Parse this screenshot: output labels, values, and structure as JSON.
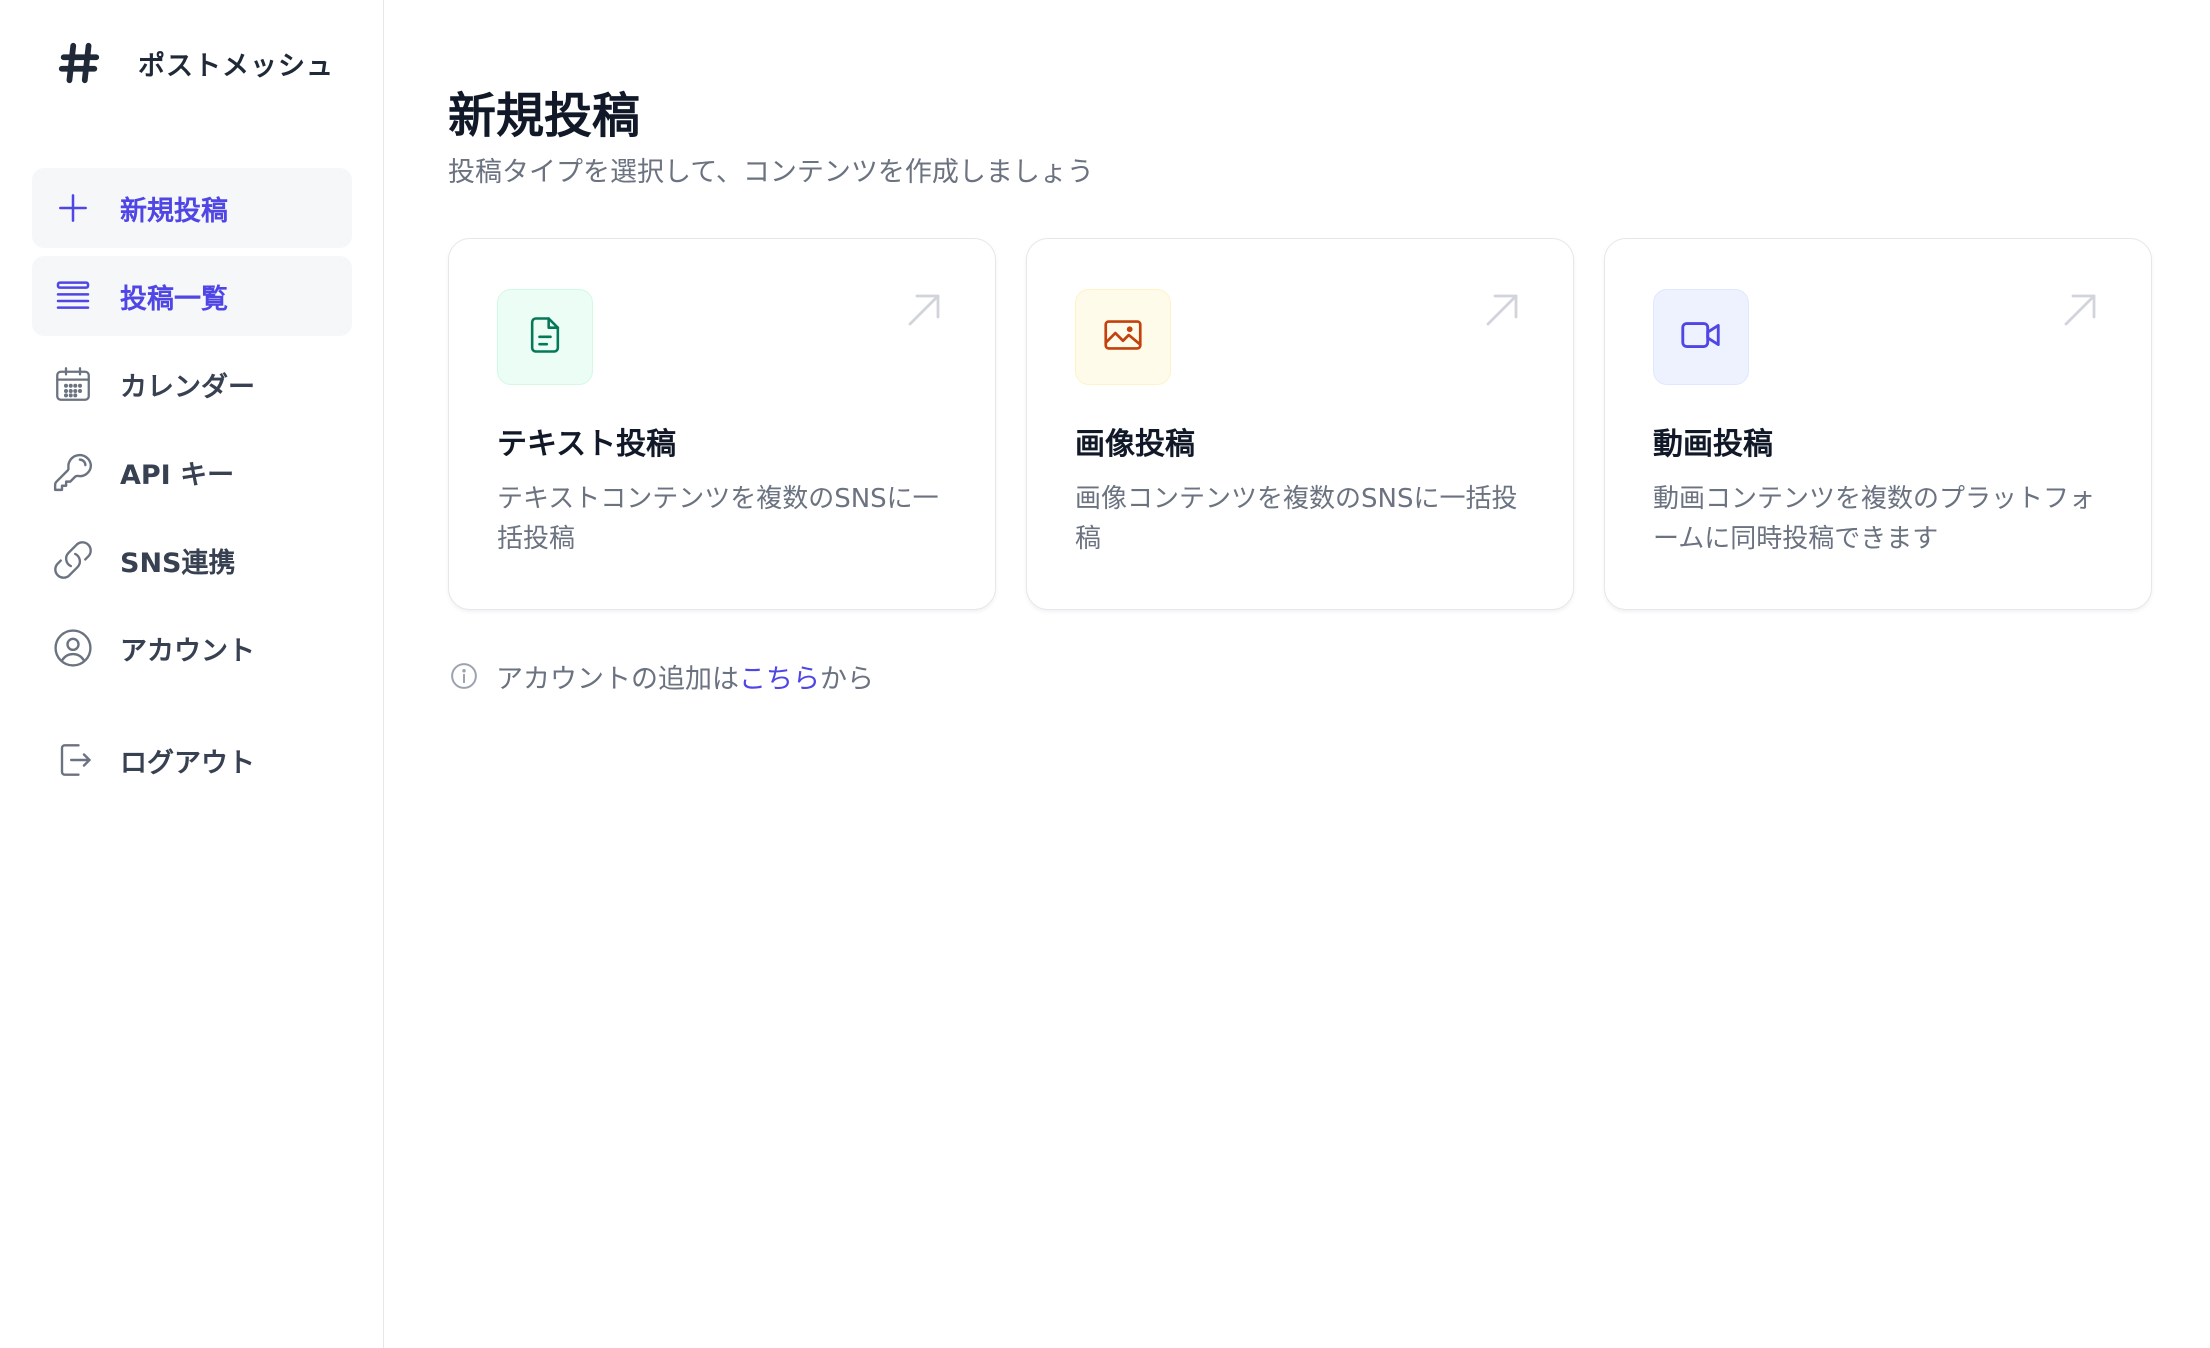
{
  "brand": {
    "icon": "hash-icon",
    "name": "ポストメッシュ"
  },
  "sidebar": {
    "items": [
      {
        "label": "新規投稿",
        "icon": "plus-icon",
        "active": true
      },
      {
        "label": "投稿一覧",
        "icon": "list-icon",
        "active": true
      },
      {
        "label": "カレンダー",
        "icon": "calendar-icon",
        "active": false
      },
      {
        "label": "API キー",
        "icon": "key-icon",
        "active": false
      },
      {
        "label": "SNS連携",
        "icon": "link-icon",
        "active": false
      },
      {
        "label": "アカウント",
        "icon": "user-circle-icon",
        "active": false
      }
    ],
    "logout": {
      "label": "ログアウト",
      "icon": "logout-icon"
    }
  },
  "main": {
    "title": "新規投稿",
    "subtitle": "投稿タイプを選択して、コンテンツを作成しましょう",
    "cards": [
      {
        "title": "テキスト投稿",
        "description": "テキストコンテンツを複数のSNSに一括投稿",
        "icon": "document-icon",
        "accent": "#047857"
      },
      {
        "title": "画像投稿",
        "description": "画像コンテンツを複数のSNSに一括投稿",
        "icon": "image-icon",
        "accent": "#c2410c"
      },
      {
        "title": "動画投稿",
        "description": "動画コンテンツを複数のプラットフォームに同時投稿できます",
        "icon": "video-icon",
        "accent": "#4f46e5"
      }
    ],
    "notice": {
      "prefix": "アカウントの追加は",
      "link": "こちら",
      "suffix": "から"
    }
  },
  "colors": {
    "accent": "#4f46e5",
    "text_primary": "#111827",
    "text_muted": "#6b7280",
    "border": "#e5e7eb"
  }
}
